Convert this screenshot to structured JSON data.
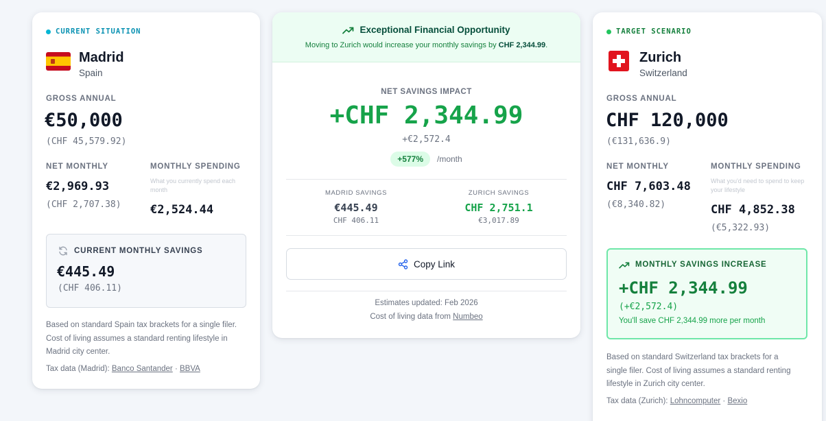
{
  "current": {
    "tag": "CURRENT SITUATION",
    "city": "Madrid",
    "country": "Spain",
    "flag_icon": "spain-flag-icon",
    "gross_label": "GROSS ANNUAL",
    "gross": "€50,000",
    "gross_alt": "(CHF 45,579.92)",
    "net_label": "NET MONTHLY",
    "net": "€2,969.93",
    "net_alt": "(CHF 2,707.38)",
    "spending_label": "MONTHLY SPENDING",
    "spending_hint": "What you currently spend each month",
    "spending": "€2,524.44",
    "savings_label": "CURRENT MONTHLY SAVINGS",
    "savings": "€445.49",
    "savings_alt": "(CHF 406.11)",
    "footnote_line1": "Based on standard Spain tax brackets for a single filer.",
    "footnote_line2": "Cost of living assumes a standard renting lifestyle in",
    "footnote_line3": "Madrid city center.",
    "tax_prefix": "Tax data (Madrid):",
    "tax_link1": "Banco Santander",
    "separator": "·",
    "tax_link2": "BBVA"
  },
  "impact": {
    "banner_title": "Exceptional Financial Opportunity",
    "banner_sub_prefix": "Moving to Zurich would increase your monthly savings by",
    "banner_sub_amount": "CHF 2,344.99",
    "banner_sub_suffix": ".",
    "net_label": "NET SAVINGS IMPACT",
    "net_amount": "+CHF 2,344.99",
    "net_alt": "+€2,572.4",
    "percent": "+577%",
    "per_month": "/month",
    "from_label": "MADRID SAVINGS",
    "from_amount": "€445.49",
    "from_alt": "CHF 406.11",
    "to_label": "ZURICH SAVINGS",
    "to_amount": "CHF 2,751.1",
    "to_alt": "€3,017.89",
    "copy_label": "Copy Link",
    "updated": "Estimates updated: Feb 2026",
    "cost_prefix": "Cost of living data from",
    "cost_link": "Numbeo"
  },
  "target": {
    "tag": "TARGET SCENARIO",
    "city": "Zurich",
    "country": "Switzerland",
    "flag_icon": "switzerland-flag-icon",
    "gross_label": "GROSS ANNUAL",
    "gross": "CHF 120,000",
    "gross_alt": "(€131,636.9)",
    "net_label": "NET MONTHLY",
    "net": "CHF 7,603.48",
    "net_alt": "(€8,340.82)",
    "spending_label": "MONTHLY SPENDING",
    "spending_hint": "What you'd need to spend to keep your lifestyle",
    "spending": "CHF 4,852.38",
    "spending_alt": "(€5,322.93)",
    "increase_label": "MONTHLY SAVINGS INCREASE",
    "increase": "+CHF 2,344.99",
    "increase_alt": "(+€2,572.4)",
    "increase_note": "You'll save CHF 2,344.99 more per month",
    "footnote_line1": "Based on standard Switzerland tax brackets for a",
    "footnote_line2": "single filer. Cost of living assumes a standard renting",
    "footnote_line3": "lifestyle in Zurich city center.",
    "tax_prefix": "Tax data (Zurich):",
    "tax_link1": "Lohncomputer",
    "separator": "·",
    "tax_link2": "Bexio"
  },
  "colors": {
    "current_accent": "#0891b2",
    "target_accent": "#16a34a",
    "positive": "#16a34a",
    "banner_bg": "#ecfdf3"
  }
}
